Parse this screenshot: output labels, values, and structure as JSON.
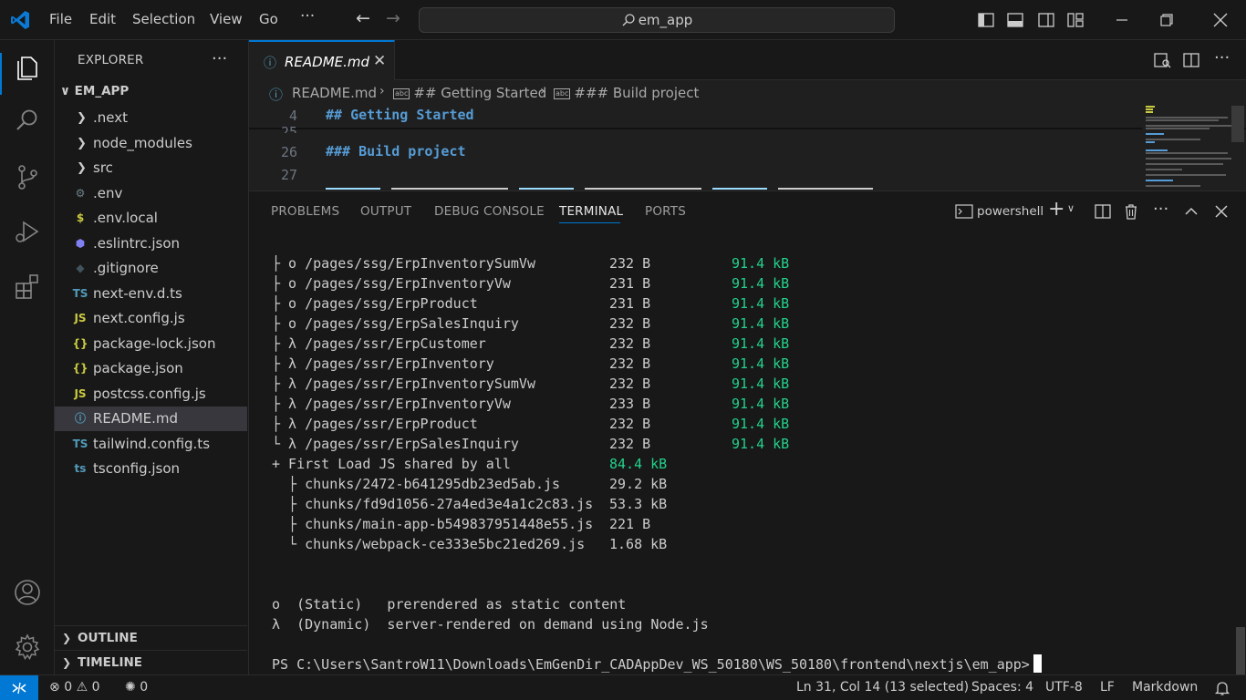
{
  "titlebar": {
    "menus": [
      "File",
      "Edit",
      "Selection",
      "View",
      "Go"
    ],
    "more": "···",
    "search_text": "em_app"
  },
  "explorer": {
    "title": "EXPLORER",
    "more": "···",
    "root": "EM_APP",
    "items": [
      {
        "name": ".next",
        "type": "folder"
      },
      {
        "name": "node_modules",
        "type": "folder"
      },
      {
        "name": "src",
        "type": "folder"
      },
      {
        "name": ".env",
        "type": "file",
        "icon": "⚙",
        "color": "#6d8086"
      },
      {
        "name": ".env.local",
        "type": "file",
        "icon": "$",
        "color": "#cbcb41"
      },
      {
        "name": ".eslintrc.json",
        "type": "file",
        "icon": "⬢",
        "color": "#8080f2"
      },
      {
        "name": ".gitignore",
        "type": "file",
        "icon": "◆",
        "color": "#41535b"
      },
      {
        "name": "next-env.d.ts",
        "type": "file",
        "icon": "TS",
        "color": "#519aba"
      },
      {
        "name": "next.config.js",
        "type": "file",
        "icon": "JS",
        "color": "#cbcb41"
      },
      {
        "name": "package-lock.json",
        "type": "file",
        "icon": "{}",
        "color": "#cbcb41"
      },
      {
        "name": "package.json",
        "type": "file",
        "icon": "{}",
        "color": "#cbcb41"
      },
      {
        "name": "postcss.config.js",
        "type": "file",
        "icon": "JS",
        "color": "#cbcb41"
      },
      {
        "name": "README.md",
        "type": "file",
        "icon": "ⓘ",
        "color": "#519aba",
        "selected": true
      },
      {
        "name": "tailwind.config.ts",
        "type": "file",
        "icon": "TS",
        "color": "#519aba"
      },
      {
        "name": "tsconfig.json",
        "type": "file",
        "icon": "ts",
        "color": "#519aba"
      }
    ],
    "outline": "OUTLINE",
    "timeline": "TIMELINE"
  },
  "editor": {
    "tab_label": "README.md",
    "tab_icon": "ⓘ",
    "tab_close": "✕",
    "breadcrumb": [
      "README.md",
      "## Getting Started",
      "### Build project"
    ],
    "lines": [
      {
        "num": "4",
        "text": "## Getting Started"
      },
      {
        "num": "25",
        "text": ""
      },
      {
        "num": "26",
        "text": "### Build project"
      },
      {
        "num": "27",
        "text": ""
      }
    ]
  },
  "panel": {
    "tabs": [
      "PROBLEMS",
      "OUTPUT",
      "DEBUG CONSOLE",
      "TERMINAL",
      "PORTS"
    ],
    "active_tab": "TERMINAL",
    "shell": "powershell",
    "routes": [
      {
        "route": "├ o /pages/ssg/ErpInventorySumVw",
        "size": "232 B",
        "first": "91.4 kB"
      },
      {
        "route": "├ o /pages/ssg/ErpInventoryVw",
        "size": "231 B",
        "first": "91.4 kB"
      },
      {
        "route": "├ o /pages/ssg/ErpProduct",
        "size": "231 B",
        "first": "91.4 kB"
      },
      {
        "route": "├ o /pages/ssg/ErpSalesInquiry",
        "size": "232 B",
        "first": "91.4 kB"
      },
      {
        "route": "├ λ /pages/ssr/ErpCustomer",
        "size": "232 B",
        "first": "91.4 kB"
      },
      {
        "route": "├ λ /pages/ssr/ErpInventory",
        "size": "232 B",
        "first": "91.4 kB"
      },
      {
        "route": "├ λ /pages/ssr/ErpInventorySumVw",
        "size": "232 B",
        "first": "91.4 kB"
      },
      {
        "route": "├ λ /pages/ssr/ErpInventoryVw",
        "size": "233 B",
        "first": "91.4 kB"
      },
      {
        "route": "├ λ /pages/ssr/ErpProduct",
        "size": "232 B",
        "first": "91.4 kB"
      },
      {
        "route": "└ λ /pages/ssr/ErpSalesInquiry",
        "size": "232 B",
        "first": "91.4 kB"
      }
    ],
    "shared_label": "+ First Load JS shared by all",
    "shared_size": "84.4 kB",
    "chunks": [
      {
        "name": "  ├ chunks/2472-b641295db23ed5ab.js",
        "size": "29.2 kB"
      },
      {
        "name": "  ├ chunks/fd9d1056-27a4ed3e4a1c2c83.js",
        "size": "53.3 kB"
      },
      {
        "name": "  ├ chunks/main-app-b549837951448e55.js",
        "size": "221 B"
      },
      {
        "name": "  └ chunks/webpack-ce333e5bc21ed269.js",
        "size": "1.68 kB"
      }
    ],
    "legend_static": "o  (Static)   prerendered as static content",
    "legend_dynamic": "λ  (Dynamic)  server-rendered on demand using Node.js",
    "prompt": "PS C:\\Users\\SantroW11\\Downloads\\EmGenDir_CADAppDev_WS_50180\\WS_50180\\frontend\\nextjs\\em_app>"
  },
  "statusbar": {
    "errors": "0",
    "warnings": "0",
    "ports": "0",
    "position": "Ln 31, Col 14 (13 selected)",
    "spaces": "Spaces: 4",
    "encoding": "UTF-8",
    "eol": "LF",
    "language": "Markdown"
  }
}
